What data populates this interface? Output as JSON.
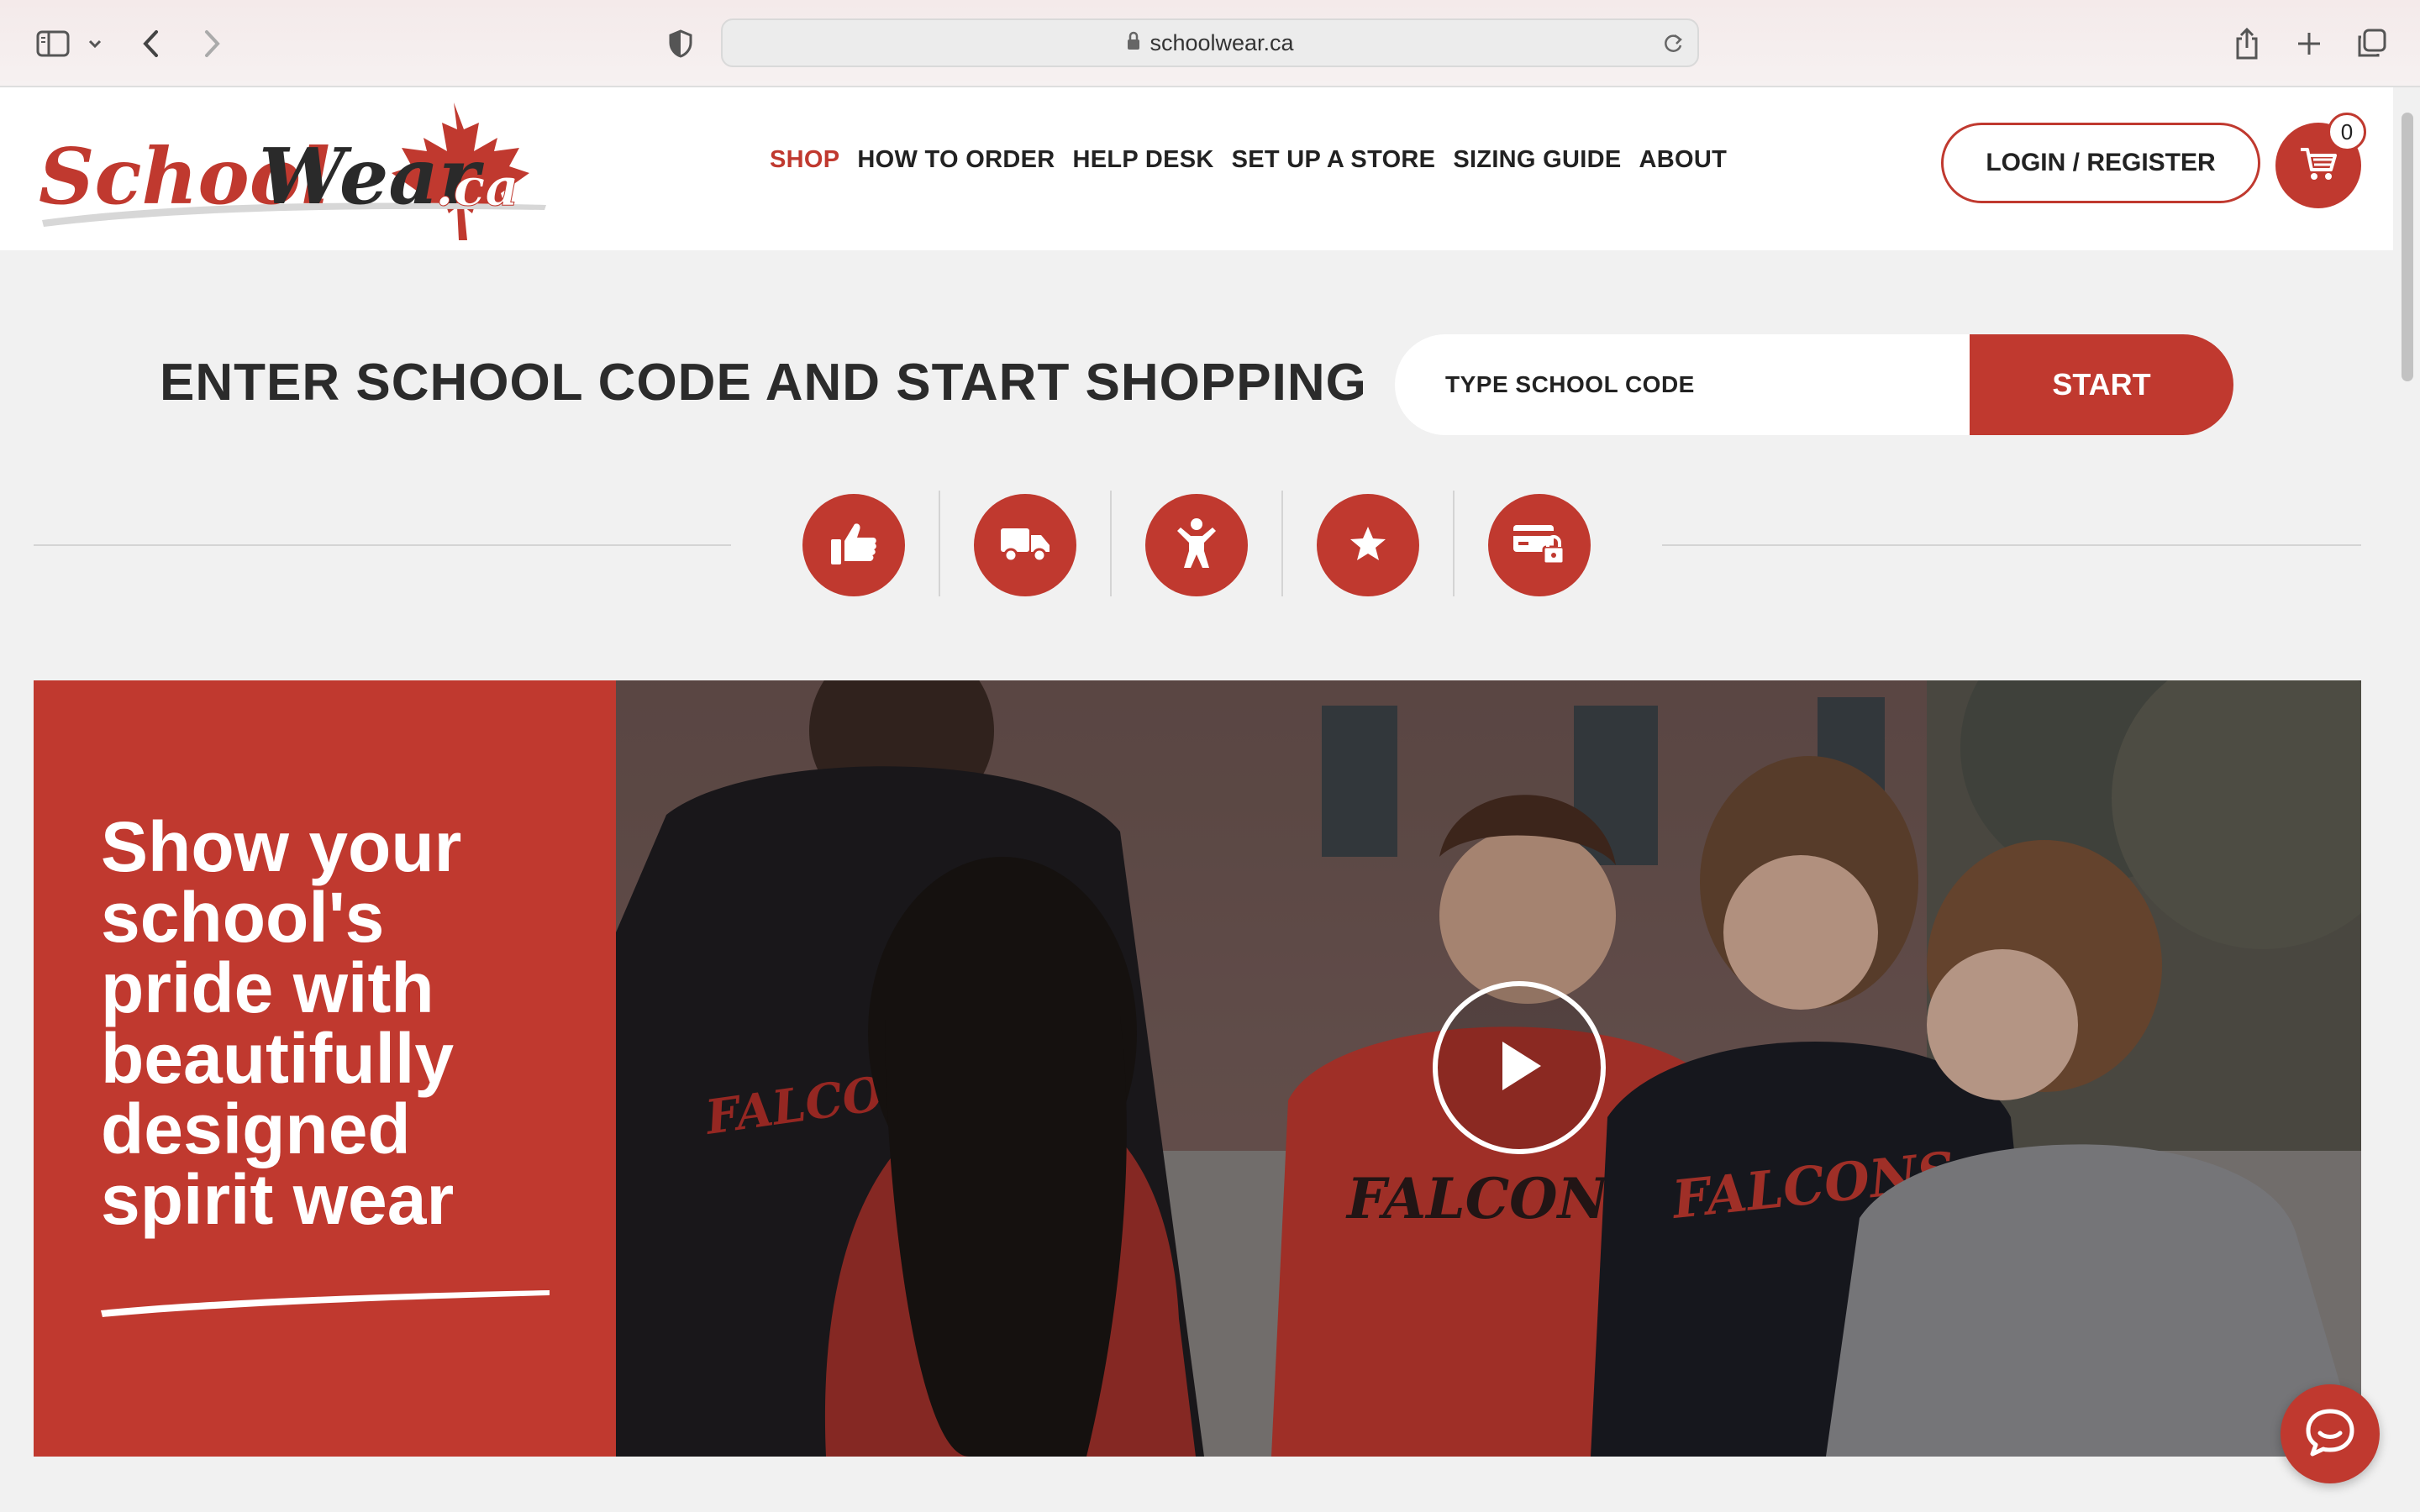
{
  "browser": {
    "url": "schoolwear.ca",
    "icons": [
      "sidebar-icon",
      "chevron-down-icon",
      "back-icon",
      "forward-icon",
      "privacy-shield-icon",
      "lock-icon",
      "reload-icon",
      "share-icon",
      "new-tab-icon",
      "tab-overview-icon"
    ]
  },
  "header": {
    "logo_text": "SchoolWear.ca",
    "nav": [
      {
        "label": "SHOP",
        "active": true
      },
      {
        "label": "HOW TO ORDER",
        "active": false
      },
      {
        "label": "HELP DESK",
        "active": false
      },
      {
        "label": "SET UP A STORE",
        "active": false
      },
      {
        "label": "SIZING GUIDE",
        "active": false
      },
      {
        "label": "ABOUT",
        "active": false
      }
    ],
    "login_label": "LOGIN / REGISTER",
    "cart_count": "0"
  },
  "school_code": {
    "title": "ENTER SCHOOL CODE AND START SHOPPING",
    "placeholder": "TYPE SCHOOL CODE",
    "button_label": "START"
  },
  "features": {
    "icons": [
      "thumbs-up-icon",
      "delivery-truck-icon",
      "person-icon",
      "star-icon",
      "secure-payment-icon"
    ]
  },
  "hero": {
    "headline": "Show your school's pride with beautifully designed spirit wear",
    "video_icon": "play-icon"
  },
  "chat": {
    "icon": "chat-icon"
  },
  "colors": {
    "brand_red": "#c0392f",
    "page_bg": "#f1f1f1",
    "text_dark": "#222222"
  }
}
